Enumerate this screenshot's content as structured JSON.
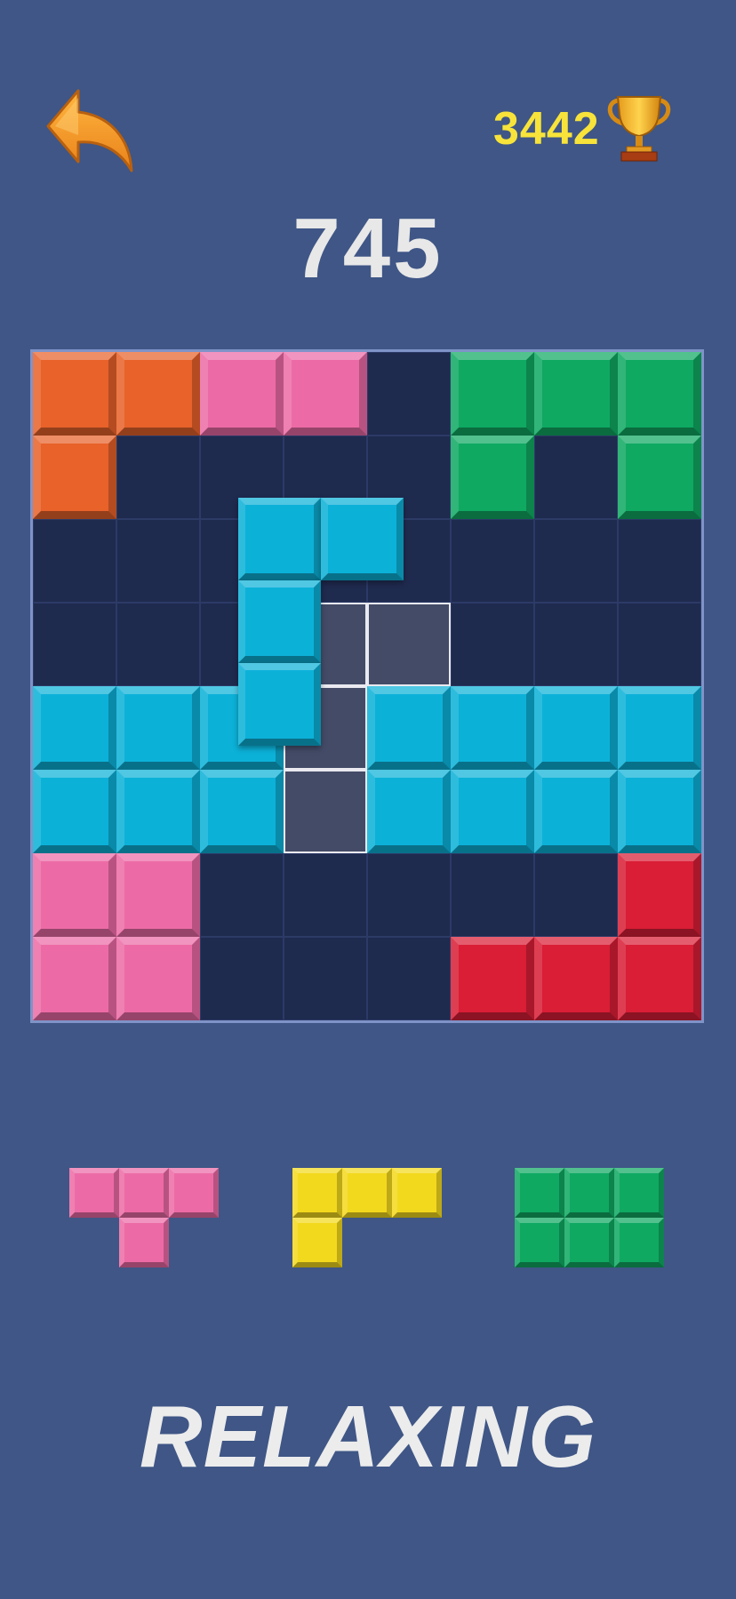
{
  "header": {
    "best_score": "3442",
    "back_icon": "back-arrow-icon",
    "trophy_icon": "trophy-icon"
  },
  "score": "745",
  "mode_label": "RELAXING",
  "colors": {
    "background": "#3f5686",
    "board": "#1f2a4f",
    "orange": "#e8622a",
    "pink": "#ec6ba6",
    "green": "#0fa962",
    "blue": "#0cb1d8",
    "red": "#d91e36",
    "yellow": "#f3d91d",
    "hint": "#434b67"
  },
  "board": {
    "size": 8,
    "cells": [
      [
        "orange",
        "orange",
        "pink",
        "pink",
        null,
        "green",
        "green",
        "green"
      ],
      [
        "orange",
        null,
        null,
        null,
        null,
        "green",
        null,
        "green"
      ],
      [
        null,
        null,
        null,
        null,
        null,
        null,
        null,
        null
      ],
      [
        null,
        null,
        null,
        null,
        null,
        null,
        null,
        null
      ],
      [
        "blue",
        "blue",
        "blue",
        null,
        "blue",
        "blue",
        "blue",
        "blue"
      ],
      [
        "blue",
        "blue",
        "blue",
        null,
        "blue",
        "blue",
        "blue",
        "blue"
      ],
      [
        "pink",
        "pink",
        null,
        null,
        null,
        null,
        null,
        "red"
      ],
      [
        "pink",
        "pink",
        null,
        null,
        null,
        "red",
        "red",
        "red"
      ]
    ],
    "placement_hint": [
      [
        3,
        3
      ],
      [
        3,
        4
      ],
      [
        4,
        3
      ],
      [
        5,
        3
      ]
    ],
    "dragged_piece": {
      "color": "blue",
      "cells": [
        [
          0,
          0
        ],
        [
          0,
          1
        ],
        [
          1,
          0
        ],
        [
          2,
          0
        ]
      ]
    }
  },
  "tray": [
    {
      "color": "pink",
      "cells": [
        [
          0,
          0
        ],
        [
          0,
          1
        ],
        [
          0,
          2
        ],
        [
          1,
          1
        ]
      ]
    },
    {
      "color": "yellow",
      "cells": [
        [
          0,
          0
        ],
        [
          0,
          1
        ],
        [
          0,
          2
        ],
        [
          1,
          0
        ]
      ]
    },
    {
      "color": "green",
      "cells": [
        [
          0,
          0
        ],
        [
          0,
          1
        ],
        [
          0,
          2
        ],
        [
          1,
          0
        ],
        [
          1,
          1
        ],
        [
          1,
          2
        ]
      ]
    }
  ]
}
